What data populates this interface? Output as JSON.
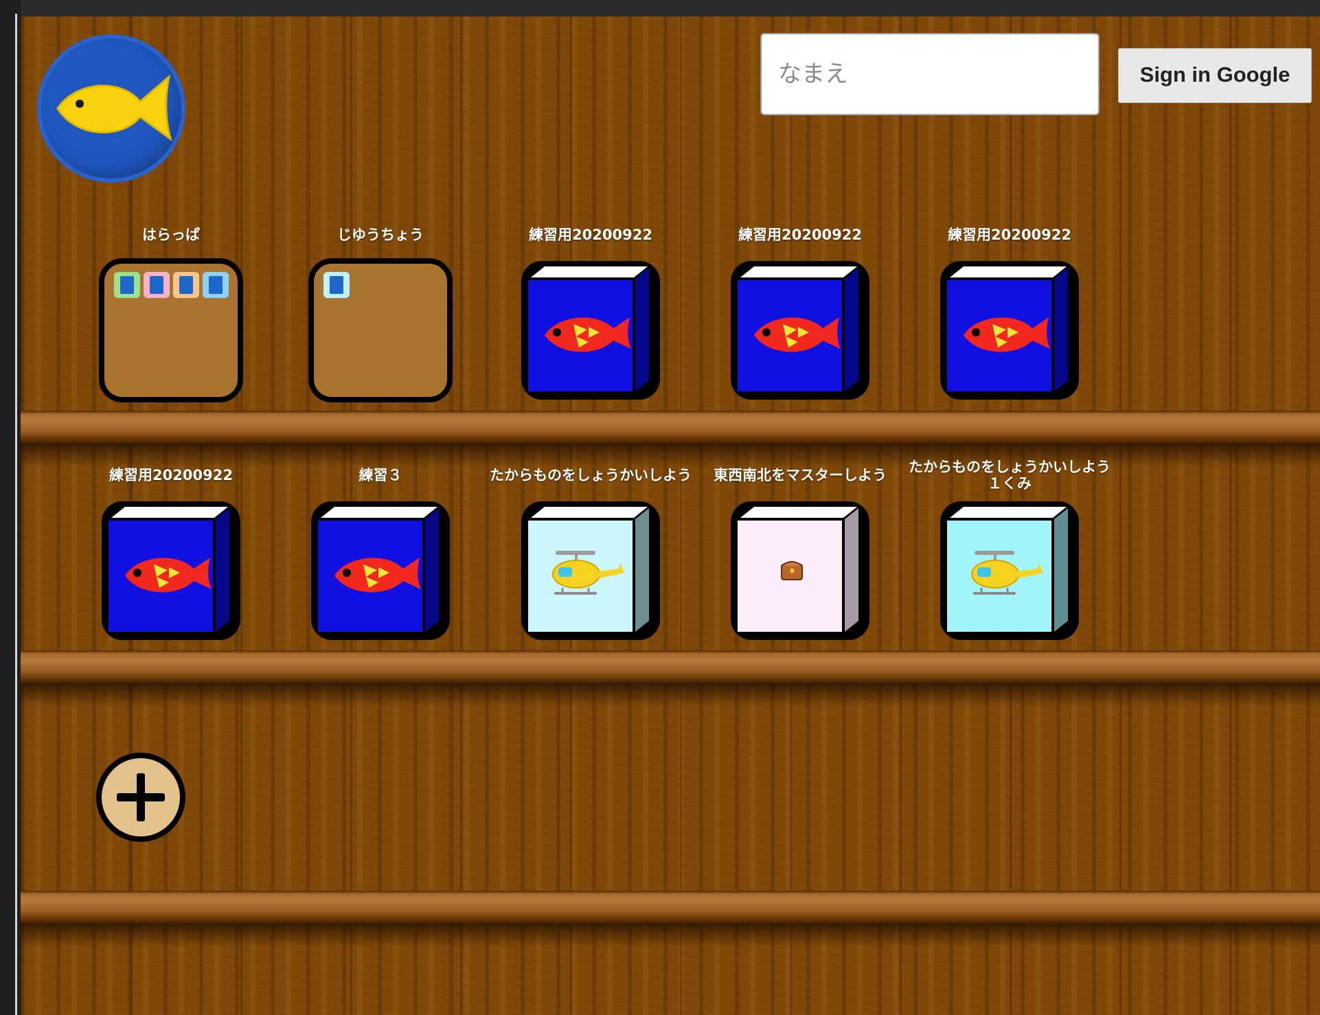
{
  "header": {
    "logo_icon": "fish-logo-icon",
    "name_placeholder": "なまえ",
    "name_value": "",
    "signin_label": "Sign in Google"
  },
  "shelves": [
    {
      "items": [
        {
          "label": "はらっぱ",
          "kind": "folder",
          "icon": "folder-icon",
          "contents": [
            "green",
            "pink",
            "orange",
            "blue"
          ]
        },
        {
          "label": "じゆうちょう",
          "kind": "folder",
          "icon": "folder-icon",
          "contents": [
            "blue"
          ]
        },
        {
          "label": "練習用20200922",
          "kind": "book",
          "icon": "fish-book-icon",
          "cover": "blue-fish"
        },
        {
          "label": "練習用20200922",
          "kind": "book",
          "icon": "fish-book-icon",
          "cover": "blue-fish"
        },
        {
          "label": "練習用20200922",
          "kind": "book",
          "icon": "fish-book-icon",
          "cover": "blue-fish"
        }
      ]
    },
    {
      "items": [
        {
          "label": "練習用20200922",
          "kind": "book",
          "icon": "fish-book-icon",
          "cover": "blue-fish"
        },
        {
          "label": "練習３",
          "kind": "book",
          "icon": "fish-book-icon",
          "cover": "blue-fish"
        },
        {
          "label": "たからものをしょうかいしよう",
          "kind": "book",
          "icon": "helicopter-book-icon",
          "cover": "cyan-helicopter"
        },
        {
          "label": "東西南北をマスターしよう",
          "kind": "book",
          "icon": "treasure-chest-book-icon",
          "cover": "pink-chest"
        },
        {
          "label": "たからものをしょうかいしよう１くみ",
          "kind": "book",
          "icon": "helicopter-book-icon",
          "cover": "cyan-helicopter"
        }
      ]
    }
  ],
  "add_button": {
    "icon": "plus-icon"
  },
  "colors": {
    "wood": "#7e4707",
    "shelf_board": "#b47a3b",
    "logo_blue": "#1f57bf",
    "fish_yellow": "#f8d20d",
    "book_blue": "#1010e0",
    "fish_red": "#f0281e",
    "folder_tan": "#a8742f",
    "add_button": "#e3c38b"
  }
}
